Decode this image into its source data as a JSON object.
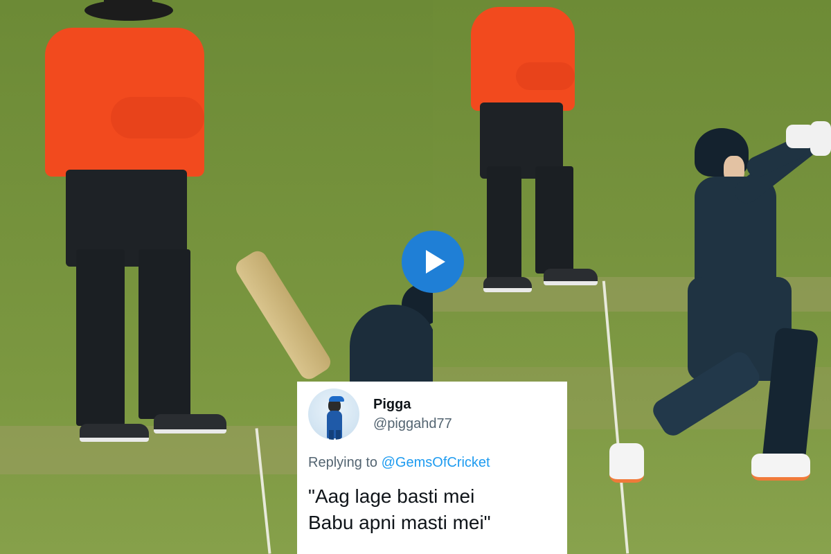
{
  "video": {
    "play_label": "Play video"
  },
  "tweet": {
    "display_name": "Pigga",
    "handle": "@piggahd77",
    "reply_prefix": "Replying to",
    "reply_to": "@GemsOfCricket",
    "text_line1": "\"Aag lage basti mei",
    "text_line2": "Babu apni masti mei\""
  },
  "colors": {
    "play_button": "#1f7fd6",
    "link": "#1d9bf0",
    "umpire_shirt": "#f24a1e",
    "outfield": "#77933e"
  },
  "icons": {
    "play": "play-triangle-icon",
    "avatar": "cartoon-cricketer-avatar"
  }
}
